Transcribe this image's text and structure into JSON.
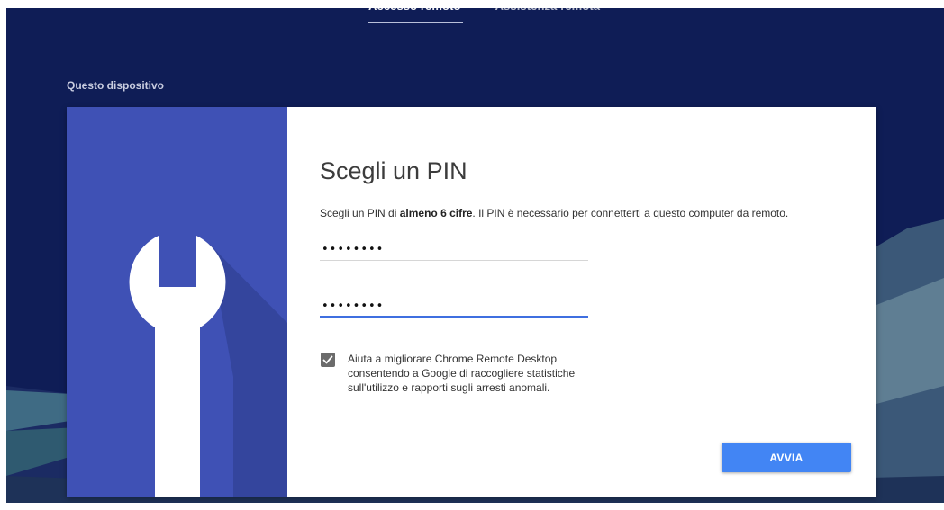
{
  "header": {
    "tabs": [
      {
        "label": "Accesso remoto",
        "active": true
      },
      {
        "label": "Assistenza remota",
        "active": false
      }
    ]
  },
  "section": {
    "label": "Questo dispositivo"
  },
  "dialog": {
    "title": "Scegli un PIN",
    "description_before": "Scegli un PIN di ",
    "description_bold": "almeno 6 cifre",
    "description_after": ". Il PIN è necessario per connetterti a questo computer da remoto.",
    "pin_value": "••••••••",
    "pin_confirm_value": "••••••••",
    "consent_checked": true,
    "consent_text": "Aiuta a migliorare Chrome Remote Desktop consentendo a Google di raccogliere statistiche sull'utilizzo e rapporti sugli arresti anomali.",
    "start_label": "AVVIA",
    "illustration_icon": "wrench-icon"
  },
  "colors": {
    "background": "#0f1d56",
    "illustration_panel": "#3f51b5",
    "primary_button": "#4285f4",
    "active_field_underline": "#3f6fe0",
    "checkbox": "#6b6b6b"
  }
}
